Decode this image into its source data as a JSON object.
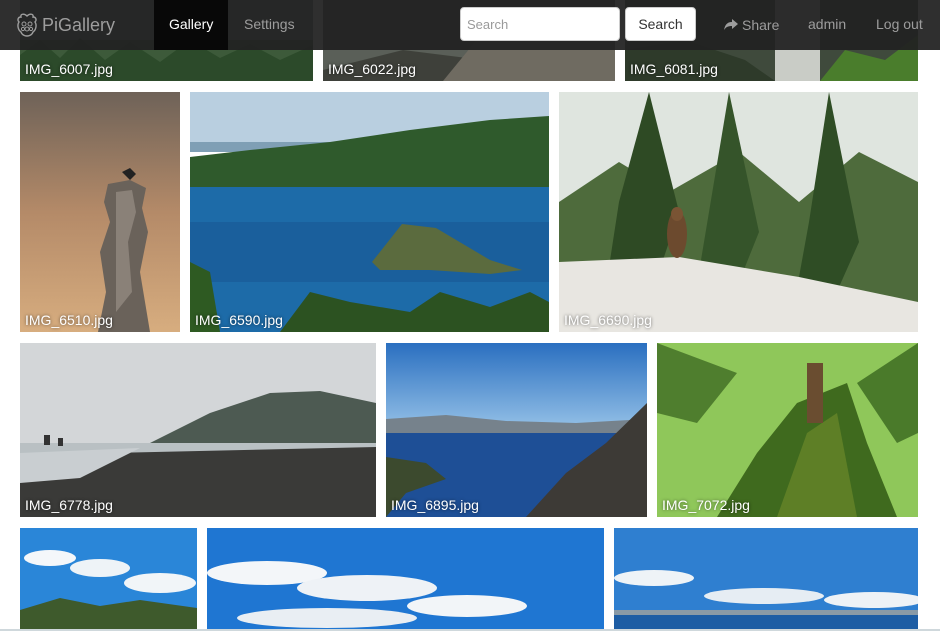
{
  "navbar": {
    "brand": "PiGallery",
    "tabs": [
      {
        "label": "Gallery",
        "active": true
      },
      {
        "label": "Settings",
        "active": false
      }
    ],
    "search": {
      "placeholder": "Search",
      "value": "",
      "button_label": "Search"
    },
    "share_label": "Share",
    "user_label": "admin",
    "logout_label": "Log out"
  },
  "photos": [
    {
      "name": "IMG_6007.jpg"
    },
    {
      "name": "IMG_6022.jpg"
    },
    {
      "name": "IMG_6081.jpg"
    },
    {
      "name": "IMG_6510.jpg"
    },
    {
      "name": "IMG_6590.jpg"
    },
    {
      "name": "IMG_6690.jpg"
    },
    {
      "name": "IMG_6778.jpg"
    },
    {
      "name": "IMG_6895.jpg"
    },
    {
      "name": "IMG_7072.jpg"
    },
    {
      "name": ""
    },
    {
      "name": ""
    },
    {
      "name": ""
    }
  ]
}
